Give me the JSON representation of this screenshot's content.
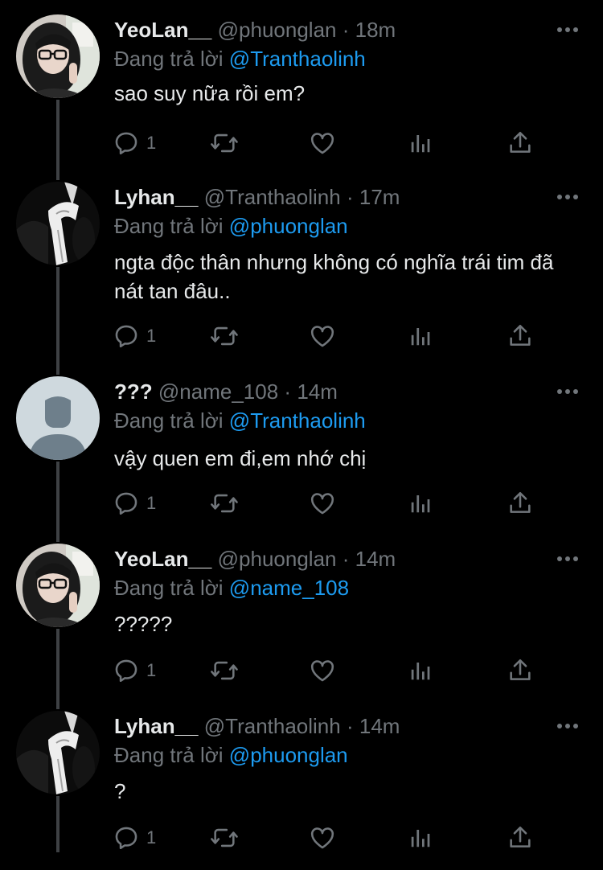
{
  "reply_prefix": "Đang trả lời",
  "dot": "·",
  "tweets": [
    {
      "display_name": "YeoLan__",
      "handle": "@phuonglan",
      "time": "18m",
      "reply_to": "@Tranthaolinh",
      "text": "sao suy nữa rồi em?",
      "reply_count": "1",
      "avatar": "woman-glasses-photo"
    },
    {
      "display_name": "Lyhan__",
      "handle": "@Tranthaolinh",
      "time": "17m",
      "reply_to": "@phuonglan",
      "text": "ngta độc thân nhưng không có nghĩa trái tim đã nát tan đâu..",
      "reply_count": "1",
      "avatar": "monochrome-figure-photo"
    },
    {
      "display_name": "???",
      "handle": "@name_108",
      "time": "14m",
      "reply_to": "@Tranthaolinh",
      "text": "vậy quen em đi,em nhớ chị",
      "reply_count": "1",
      "avatar": "default-profile-placeholder"
    },
    {
      "display_name": "YeoLan__",
      "handle": "@phuonglan",
      "time": "14m",
      "reply_to": "@name_108",
      "text": "?????",
      "reply_count": "1",
      "avatar": "woman-glasses-photo"
    },
    {
      "display_name": "Lyhan__",
      "handle": "@Tranthaolinh",
      "time": "14m",
      "reply_to": "@phuonglan",
      "text": "?",
      "reply_count": "1",
      "avatar": "monochrome-figure-photo"
    }
  ],
  "colors": {
    "background": "#000000",
    "text_primary": "#e7e9ea",
    "text_secondary": "#71767b",
    "mention": "#1d9bf0",
    "thread_line": "#3e4144"
  },
  "icons": {
    "reply": "speech-bubble-icon",
    "retweet": "retweet-arrows-icon",
    "like": "heart-icon",
    "analytics": "bar-chart-icon",
    "share": "upload-share-icon",
    "more": "more-dots-icon"
  }
}
